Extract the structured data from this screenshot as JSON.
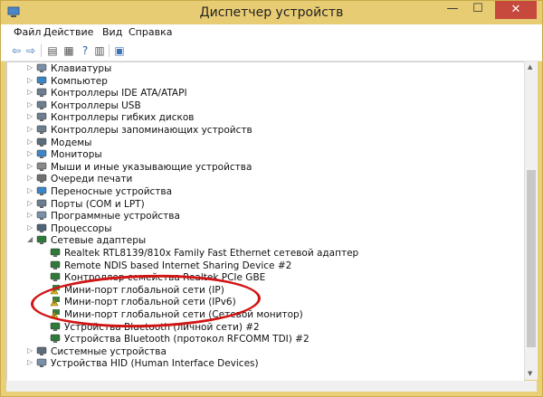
{
  "window": {
    "title": "Диспетчер устройств"
  },
  "menu": [
    "Файл",
    "Действие",
    "Вид",
    "Справка"
  ],
  "tree": [
    {
      "label": "Клавиатуры",
      "expanded": false,
      "icon": "keyboard-icon",
      "color": "#7a8fa8"
    },
    {
      "label": "Компьютер",
      "expanded": false,
      "icon": "computer-icon",
      "color": "#3d86c6"
    },
    {
      "label": "Контроллеры IDE ATA/ATAPI",
      "expanded": false,
      "icon": "ide-controller-icon",
      "color": "#6d7f8f"
    },
    {
      "label": "Контроллеры USB",
      "expanded": false,
      "icon": "usb-controller-icon",
      "color": "#6d7f8f"
    },
    {
      "label": "Контроллеры гибких дисков",
      "expanded": false,
      "icon": "floppy-controller-icon",
      "color": "#6d7f8f"
    },
    {
      "label": "Контроллеры запоминающих устройств",
      "expanded": false,
      "icon": "storage-controller-icon",
      "color": "#6d7f8f"
    },
    {
      "label": "Модемы",
      "expanded": false,
      "icon": "modem-icon",
      "color": "#5d6d7d"
    },
    {
      "label": "Мониторы",
      "expanded": false,
      "icon": "monitor-icon",
      "color": "#3d86c6"
    },
    {
      "label": "Мыши и иные указывающие устройства",
      "expanded": false,
      "icon": "mouse-icon",
      "color": "#8a8a8a"
    },
    {
      "label": "Очереди печати",
      "expanded": false,
      "icon": "printer-icon",
      "color": "#707070"
    },
    {
      "label": "Переносные устройства",
      "expanded": false,
      "icon": "portable-device-icon",
      "color": "#3d86c6"
    },
    {
      "label": "Порты (COM и LPT)",
      "expanded": false,
      "icon": "port-icon",
      "color": "#6d7f8f"
    },
    {
      "label": "Программные устройства",
      "expanded": false,
      "icon": "software-device-icon",
      "color": "#7a8fa8"
    },
    {
      "label": "Процессоры",
      "expanded": false,
      "icon": "processor-icon",
      "color": "#4f6478"
    },
    {
      "label": "Сетевые адаптеры",
      "expanded": true,
      "icon": "network-adapter-icon",
      "color": "#2f7a3a"
    },
    {
      "label": "Realtek RTL8139/810x Family Fast Ethernet сетевой адаптер",
      "child": true,
      "icon": "network-adapter-icon",
      "color": "#2f7a3a"
    },
    {
      "label": "Remote NDIS based Internet Sharing Device #2",
      "child": true,
      "icon": "network-adapter-icon",
      "color": "#2f7a3a"
    },
    {
      "label": "Контроллер семейства Realtek PCIe GBE",
      "child": true,
      "icon": "network-adapter-icon",
      "color": "#2f7a3a"
    },
    {
      "label": "Мини-порт глобальной сети (IP)",
      "child": true,
      "icon": "warning-network-icon",
      "color": "#d8b81c"
    },
    {
      "label": "Мини-порт глобальной сети (IPv6)",
      "child": true,
      "icon": "warning-network-icon",
      "color": "#d8b81c"
    },
    {
      "label": "Мини-порт глобальной сети (Сетевой монитор)",
      "child": true,
      "icon": "warning-network-icon",
      "color": "#d8b81c"
    },
    {
      "label": "Устройства Bluetooth (личной сети) #2",
      "child": true,
      "icon": "network-adapter-icon",
      "color": "#2f7a3a"
    },
    {
      "label": "Устройства Bluetooth (протокол RFCOMM TDI) #2",
      "child": true,
      "icon": "network-adapter-icon",
      "color": "#2f7a3a"
    },
    {
      "label": "Системные устройства",
      "expanded": false,
      "icon": "system-device-icon",
      "color": "#5d6d7d"
    },
    {
      "label": "Устройства HID (Human Interface Devices)",
      "expanded": false,
      "icon": "hid-device-icon",
      "color": "#7a8fa8"
    }
  ]
}
